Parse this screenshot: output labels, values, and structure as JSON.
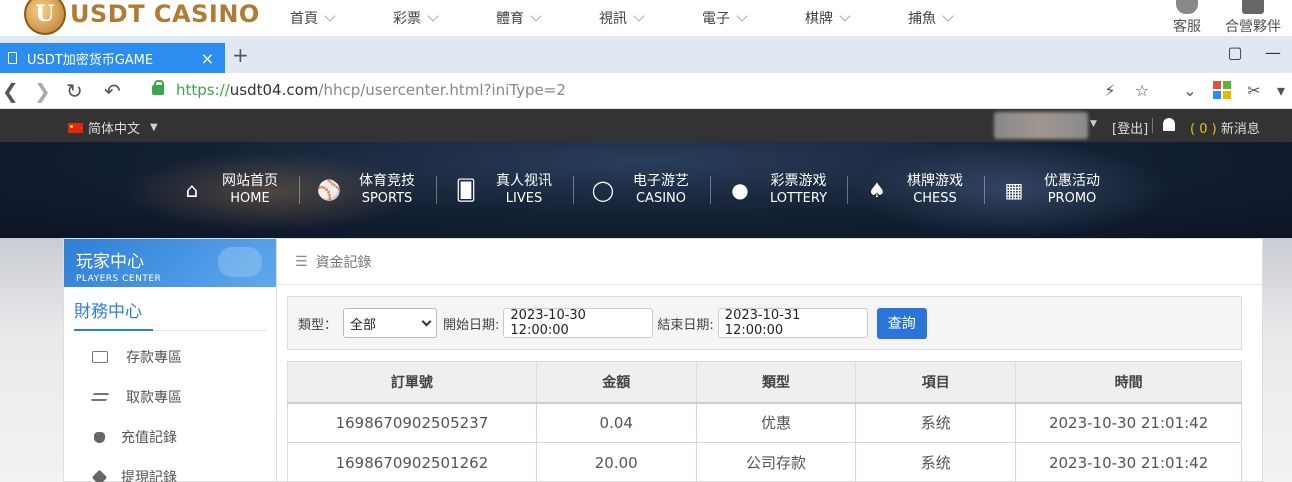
{
  "site_top": {
    "logo_text": "USDT CASINO",
    "logo_letter": "U",
    "nav": [
      "首頁",
      "彩票",
      "體育",
      "視訊",
      "電子",
      "棋牌",
      "捕魚"
    ],
    "right": [
      "客服",
      "合營夥伴"
    ]
  },
  "browser": {
    "tab_title": "USDT加密货币GAME",
    "tab_close": "×",
    "new_tab": "+",
    "url_scheme": "https://",
    "url_domain": "usdt04.com",
    "url_path": "/hhcp/usercenter.html?iniType=2"
  },
  "topbar": {
    "language": "简体中文",
    "logout": "[登出]",
    "messages_count": "( 0 )",
    "messages_label": "新消息"
  },
  "categories": [
    {
      "cn": "网站首页",
      "en": "HOME",
      "icon": "home-icon"
    },
    {
      "cn": "体育竞技",
      "en": "SPORTS",
      "icon": "basketball-icon"
    },
    {
      "cn": "真人视讯",
      "en": "LIVES",
      "icon": "cards-icon"
    },
    {
      "cn": "电子游艺",
      "en": "CASINO",
      "icon": "slot-icon"
    },
    {
      "cn": "彩票游戏",
      "en": "LOTTERY",
      "icon": "lottery-balls-icon"
    },
    {
      "cn": "棋牌游戏",
      "en": "CHESS",
      "icon": "spade-icon"
    },
    {
      "cn": "优惠活动",
      "en": "PROMO",
      "icon": "gift-icon"
    }
  ],
  "sidebar": {
    "title": "玩家中心",
    "subtitle": "PLAYERS CENTER",
    "section": "財務中心",
    "items": [
      {
        "label": "存款專區",
        "icon": "card-icon"
      },
      {
        "label": "取款專區",
        "icon": "cash-icon"
      },
      {
        "label": "充值記錄",
        "icon": "money-bag-icon"
      },
      {
        "label": "提現記錄",
        "icon": "withdraw-icon"
      }
    ]
  },
  "main": {
    "heading": "資金記錄",
    "filter": {
      "type_label": "類型：",
      "type_value": "全部",
      "start_label": "開始日期:",
      "start_value": "2023-10-30 12:00:00",
      "end_label": "結束日期:",
      "end_value": "2023-10-31 12:00:00",
      "query_button": "查詢"
    },
    "table": {
      "headers": [
        "訂單號",
        "金額",
        "類型",
        "項目",
        "時間"
      ],
      "rows": [
        [
          "1698670902505237",
          "0.04",
          "优惠",
          "系统",
          "2023-10-30 21:01:42"
        ],
        [
          "1698670902501262",
          "20.00",
          "公司存款",
          "系统",
          "2023-10-30 21:01:42"
        ]
      ]
    }
  }
}
